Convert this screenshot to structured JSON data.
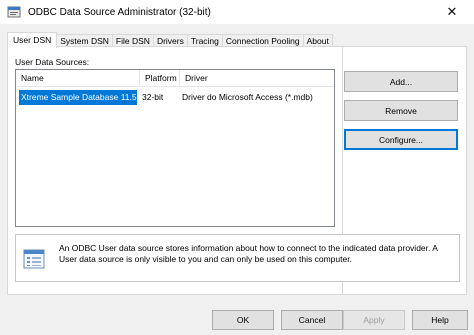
{
  "window": {
    "title": "ODBC Data Source Administrator (32-bit)",
    "close_glyph": "✕"
  },
  "tabs": [
    {
      "label": "User DSN",
      "active": true
    },
    {
      "label": "System DSN"
    },
    {
      "label": "File DSN"
    },
    {
      "label": "Drivers"
    },
    {
      "label": "Tracing"
    },
    {
      "label": "Connection Pooling"
    },
    {
      "label": "About"
    }
  ],
  "user_dsn": {
    "sources_label": "User Data Sources:",
    "columns": [
      "Name",
      "Platform",
      "Driver"
    ],
    "rows": [
      {
        "name": "Xtreme Sample Database 11.5",
        "platform": "32-bit",
        "driver": "Driver do Microsoft Access (*.mdb)",
        "selected": true
      }
    ],
    "buttons": {
      "add": "Add...",
      "remove": "Remove",
      "configure": "Configure..."
    },
    "info_text": "An ODBC User data source stores information about how to connect to the indicated data provider.  A User data source is only visible to you and can only be used on this computer."
  },
  "footer": {
    "ok": "OK",
    "cancel": "Cancel",
    "apply": "Apply",
    "help": "Help"
  },
  "colors": {
    "selection": "#0078d7",
    "focus_border": "#0078d7",
    "window_bg": "#f0f0f0"
  },
  "icons": {
    "app": "odbc-app-icon",
    "info": "database-list-icon"
  }
}
